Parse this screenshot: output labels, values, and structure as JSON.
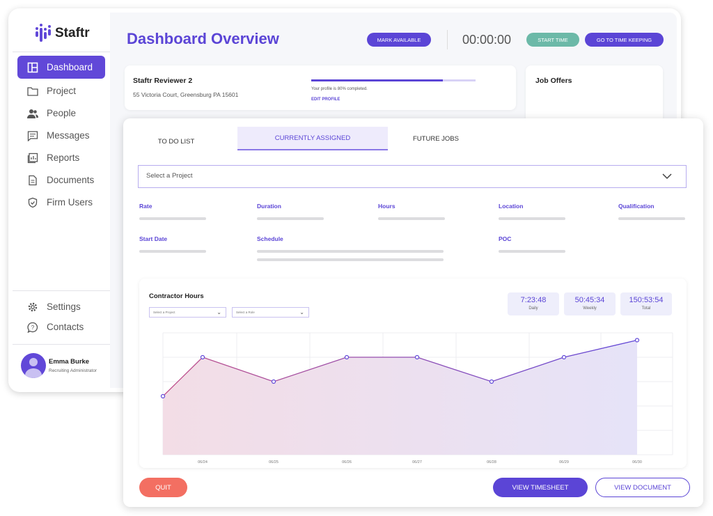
{
  "brand": {
    "name": "Staftr",
    "accent": "#6148d8"
  },
  "sidebar": {
    "items": [
      {
        "label": "Dashboard",
        "icon": "dashboard-icon",
        "active": true
      },
      {
        "label": "Project",
        "icon": "folder-icon"
      },
      {
        "label": "People",
        "icon": "people-icon"
      },
      {
        "label": "Messages",
        "icon": "message-icon"
      },
      {
        "label": "Reports",
        "icon": "reports-icon"
      },
      {
        "label": "Documents",
        "icon": "document-icon"
      },
      {
        "label": "Firm Users",
        "icon": "shield-icon"
      }
    ],
    "bottom": [
      {
        "label": "Settings",
        "icon": "gear-icon"
      },
      {
        "label": "Contacts",
        "icon": "help-chat-icon"
      }
    ],
    "user": {
      "name": "Emma Burke",
      "role": "Recruiting Administrator"
    }
  },
  "header": {
    "title": "Dashboard Overview",
    "mark_available": "MARK AVAILABLE",
    "timer": "00:00:00",
    "start_time": "START TIME",
    "go_time": "GO TO TIME KEEPING"
  },
  "profile": {
    "name": "Staftr Reviewer 2",
    "address": "55 Victoria Court, Greensburg PA 15601",
    "progress_text": "Your profile is 80% completed.",
    "progress": 80,
    "edit": "EDIT PROFILE"
  },
  "job_offers": {
    "title": "Job Offers"
  },
  "tabs": [
    {
      "label": "TO DO LIST"
    },
    {
      "label": "CURRENTLY ASSIGNED",
      "active": true
    },
    {
      "label": "FUTURE JOBS"
    }
  ],
  "project_select": {
    "placeholder": "Select a Project"
  },
  "fields": {
    "rate": "Rate",
    "duration": "Duration",
    "hours": "Hours",
    "location": "Location",
    "qualification": "Qualification",
    "start_date": "Start Date",
    "schedule": "Schedule",
    "poc": "POC"
  },
  "hours_panel": {
    "title": "Contractor Hours",
    "project_select": "Select a Project",
    "role_select": "Select a Role",
    "stats": [
      {
        "value": "7:23:48",
        "label": "Daily"
      },
      {
        "value": "50:45:34",
        "label": "Weekly"
      },
      {
        "value": "150:53:54",
        "label": "Total"
      }
    ]
  },
  "chart_data": {
    "type": "area",
    "categories": [
      "",
      "06/24",
      "06/25",
      "06/26",
      "06/27",
      "06/28",
      "06/29",
      "06/30"
    ],
    "values": [
      2.4,
      4,
      3,
      4,
      4,
      3,
      4,
      4.7
    ],
    "ylim": [
      0,
      5
    ],
    "grid": true,
    "colors": [
      "#c0508a",
      "#6148d8"
    ]
  },
  "footer": {
    "quit": "QUIT",
    "view_timesheet": "VIEW TIMESHEET",
    "view_document": "VIEW DOCUMENT"
  }
}
